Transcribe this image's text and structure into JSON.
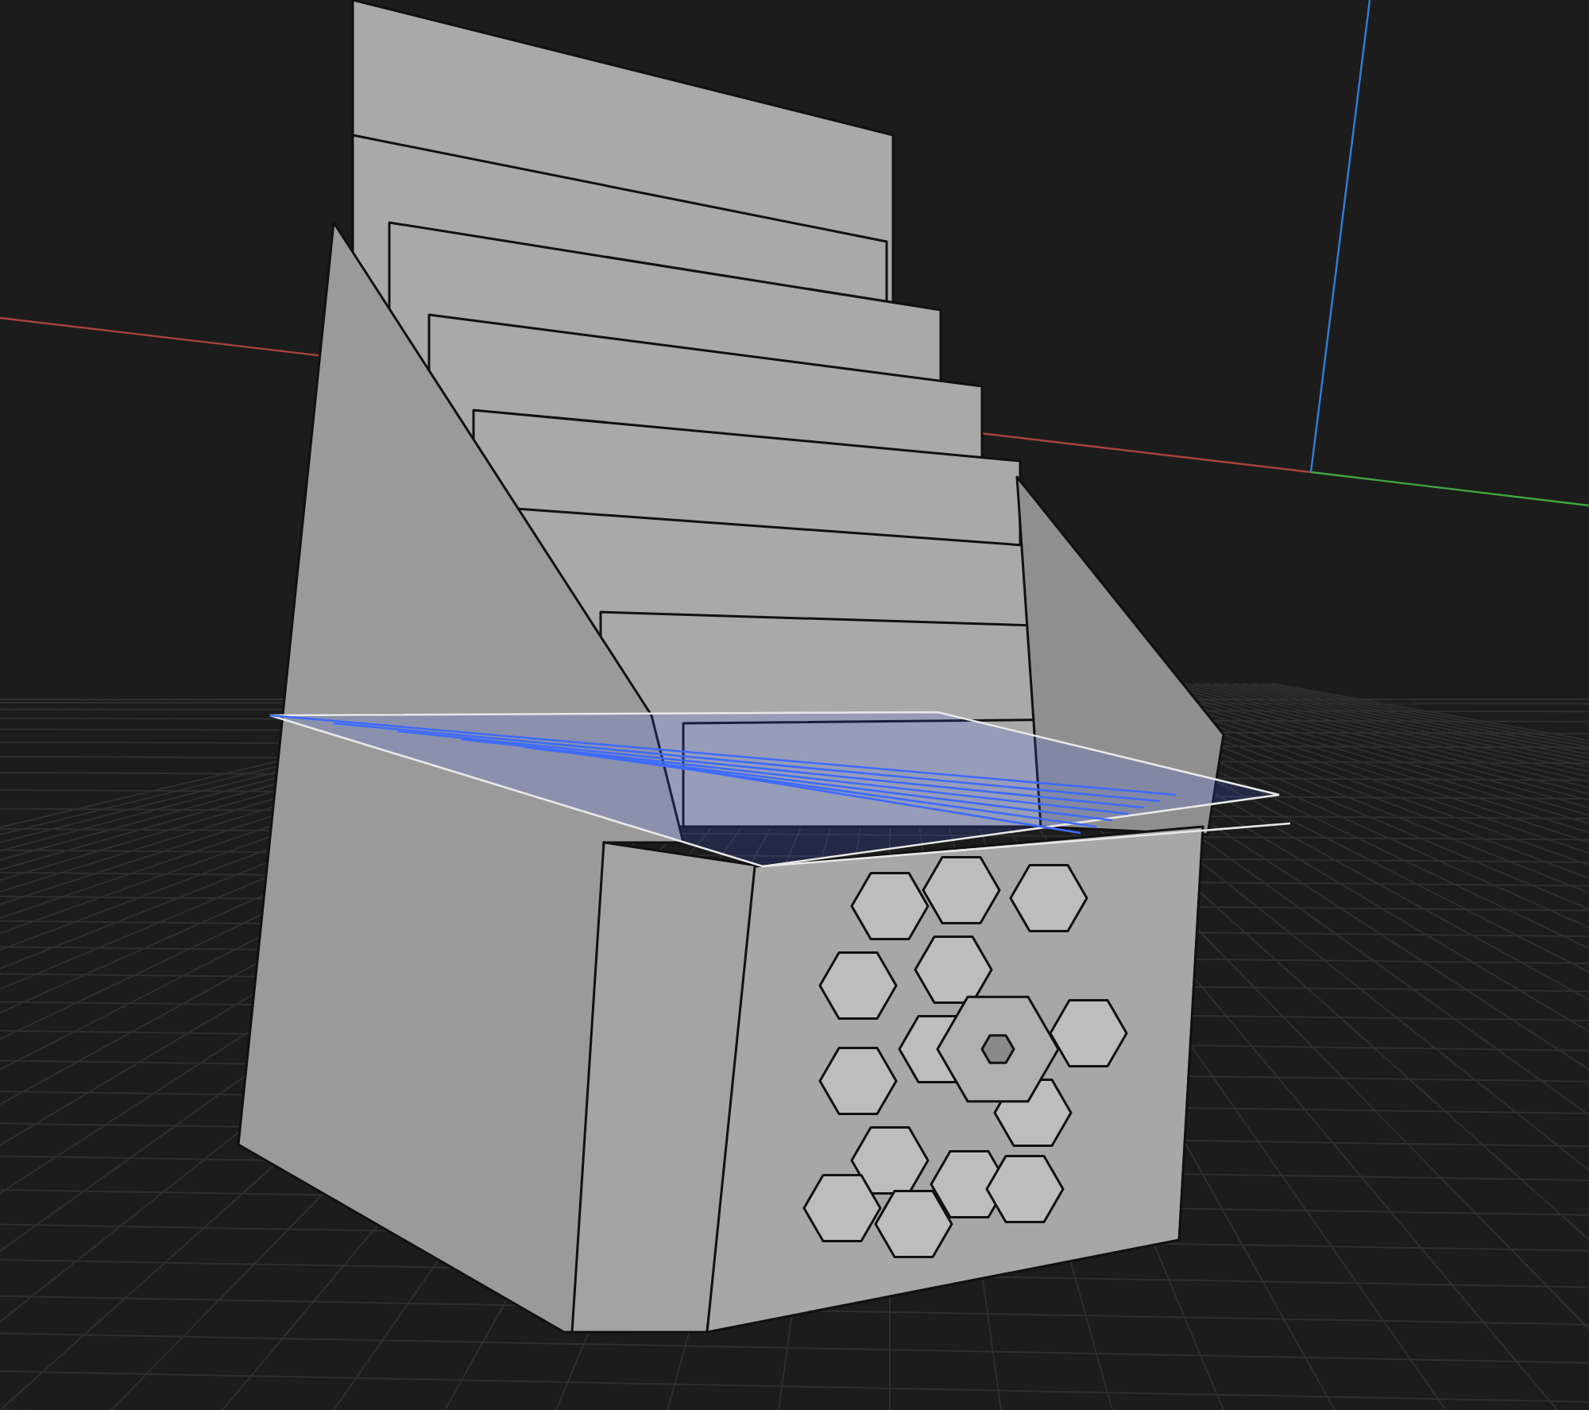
{
  "viewport": {
    "grid": true,
    "axes": true
  },
  "model": {
    "section_plane_selected": true
  }
}
